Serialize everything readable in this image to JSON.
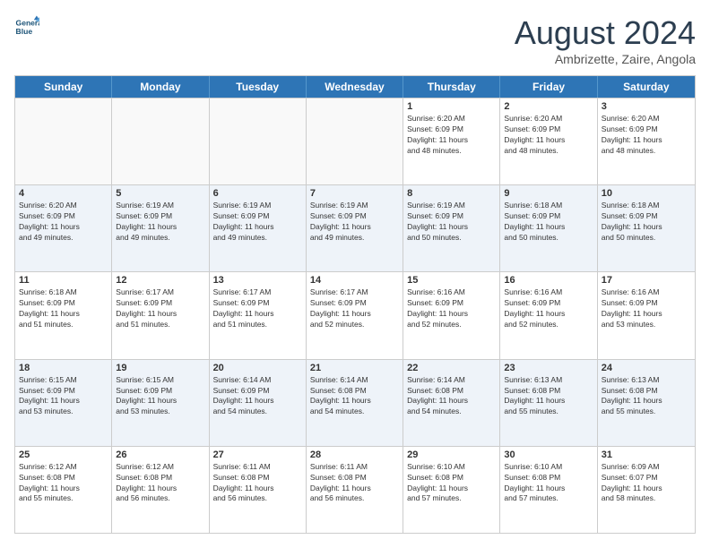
{
  "logo": {
    "line1": "General",
    "line2": "Blue"
  },
  "title": "August 2024",
  "subtitle": "Ambrizette, Zaire, Angola",
  "header_days": [
    "Sunday",
    "Monday",
    "Tuesday",
    "Wednesday",
    "Thursday",
    "Friday",
    "Saturday"
  ],
  "weeks": [
    [
      {
        "day": "",
        "info": "",
        "empty": true
      },
      {
        "day": "",
        "info": "",
        "empty": true
      },
      {
        "day": "",
        "info": "",
        "empty": true
      },
      {
        "day": "",
        "info": "",
        "empty": true
      },
      {
        "day": "1",
        "info": "Sunrise: 6:20 AM\nSunset: 6:09 PM\nDaylight: 11 hours\nand 48 minutes."
      },
      {
        "day": "2",
        "info": "Sunrise: 6:20 AM\nSunset: 6:09 PM\nDaylight: 11 hours\nand 48 minutes."
      },
      {
        "day": "3",
        "info": "Sunrise: 6:20 AM\nSunset: 6:09 PM\nDaylight: 11 hours\nand 48 minutes."
      }
    ],
    [
      {
        "day": "4",
        "info": "Sunrise: 6:20 AM\nSunset: 6:09 PM\nDaylight: 11 hours\nand 49 minutes."
      },
      {
        "day": "5",
        "info": "Sunrise: 6:19 AM\nSunset: 6:09 PM\nDaylight: 11 hours\nand 49 minutes."
      },
      {
        "day": "6",
        "info": "Sunrise: 6:19 AM\nSunset: 6:09 PM\nDaylight: 11 hours\nand 49 minutes."
      },
      {
        "day": "7",
        "info": "Sunrise: 6:19 AM\nSunset: 6:09 PM\nDaylight: 11 hours\nand 49 minutes."
      },
      {
        "day": "8",
        "info": "Sunrise: 6:19 AM\nSunset: 6:09 PM\nDaylight: 11 hours\nand 50 minutes."
      },
      {
        "day": "9",
        "info": "Sunrise: 6:18 AM\nSunset: 6:09 PM\nDaylight: 11 hours\nand 50 minutes."
      },
      {
        "day": "10",
        "info": "Sunrise: 6:18 AM\nSunset: 6:09 PM\nDaylight: 11 hours\nand 50 minutes."
      }
    ],
    [
      {
        "day": "11",
        "info": "Sunrise: 6:18 AM\nSunset: 6:09 PM\nDaylight: 11 hours\nand 51 minutes."
      },
      {
        "day": "12",
        "info": "Sunrise: 6:17 AM\nSunset: 6:09 PM\nDaylight: 11 hours\nand 51 minutes."
      },
      {
        "day": "13",
        "info": "Sunrise: 6:17 AM\nSunset: 6:09 PM\nDaylight: 11 hours\nand 51 minutes."
      },
      {
        "day": "14",
        "info": "Sunrise: 6:17 AM\nSunset: 6:09 PM\nDaylight: 11 hours\nand 52 minutes."
      },
      {
        "day": "15",
        "info": "Sunrise: 6:16 AM\nSunset: 6:09 PM\nDaylight: 11 hours\nand 52 minutes."
      },
      {
        "day": "16",
        "info": "Sunrise: 6:16 AM\nSunset: 6:09 PM\nDaylight: 11 hours\nand 52 minutes."
      },
      {
        "day": "17",
        "info": "Sunrise: 6:16 AM\nSunset: 6:09 PM\nDaylight: 11 hours\nand 53 minutes."
      }
    ],
    [
      {
        "day": "18",
        "info": "Sunrise: 6:15 AM\nSunset: 6:09 PM\nDaylight: 11 hours\nand 53 minutes."
      },
      {
        "day": "19",
        "info": "Sunrise: 6:15 AM\nSunset: 6:09 PM\nDaylight: 11 hours\nand 53 minutes."
      },
      {
        "day": "20",
        "info": "Sunrise: 6:14 AM\nSunset: 6:09 PM\nDaylight: 11 hours\nand 54 minutes."
      },
      {
        "day": "21",
        "info": "Sunrise: 6:14 AM\nSunset: 6:08 PM\nDaylight: 11 hours\nand 54 minutes."
      },
      {
        "day": "22",
        "info": "Sunrise: 6:14 AM\nSunset: 6:08 PM\nDaylight: 11 hours\nand 54 minutes."
      },
      {
        "day": "23",
        "info": "Sunrise: 6:13 AM\nSunset: 6:08 PM\nDaylight: 11 hours\nand 55 minutes."
      },
      {
        "day": "24",
        "info": "Sunrise: 6:13 AM\nSunset: 6:08 PM\nDaylight: 11 hours\nand 55 minutes."
      }
    ],
    [
      {
        "day": "25",
        "info": "Sunrise: 6:12 AM\nSunset: 6:08 PM\nDaylight: 11 hours\nand 55 minutes."
      },
      {
        "day": "26",
        "info": "Sunrise: 6:12 AM\nSunset: 6:08 PM\nDaylight: 11 hours\nand 56 minutes."
      },
      {
        "day": "27",
        "info": "Sunrise: 6:11 AM\nSunset: 6:08 PM\nDaylight: 11 hours\nand 56 minutes."
      },
      {
        "day": "28",
        "info": "Sunrise: 6:11 AM\nSunset: 6:08 PM\nDaylight: 11 hours\nand 56 minutes."
      },
      {
        "day": "29",
        "info": "Sunrise: 6:10 AM\nSunset: 6:08 PM\nDaylight: 11 hours\nand 57 minutes."
      },
      {
        "day": "30",
        "info": "Sunrise: 6:10 AM\nSunset: 6:08 PM\nDaylight: 11 hours\nand 57 minutes."
      },
      {
        "day": "31",
        "info": "Sunrise: 6:09 AM\nSunset: 6:07 PM\nDaylight: 11 hours\nand 58 minutes."
      }
    ]
  ]
}
